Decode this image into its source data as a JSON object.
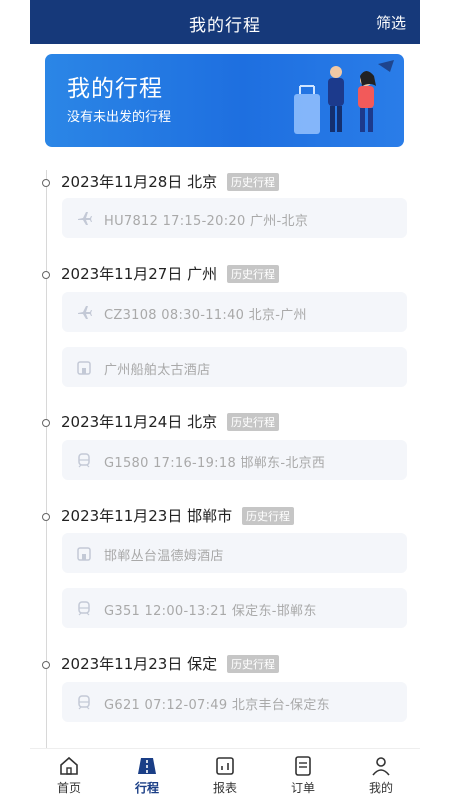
{
  "header": {
    "title": "我的行程",
    "filter_label": "筛选"
  },
  "banner": {
    "title": "我的行程",
    "subtitle": "没有未出发的行程"
  },
  "days": [
    {
      "date": "2023年11月28日 北京",
      "tag": "历史行程",
      "items": [
        {
          "icon": "plane-icon",
          "text": "HU7812 17:15-20:20 广州-北京"
        }
      ]
    },
    {
      "date": "2023年11月27日 广州",
      "tag": "历史行程",
      "items": [
        {
          "icon": "plane-icon",
          "text": "CZ3108 08:30-11:40 北京-广州"
        },
        {
          "icon": "hotel-icon",
          "text": "广州船舶太古酒店"
        }
      ]
    },
    {
      "date": "2023年11月24日 北京",
      "tag": "历史行程",
      "items": [
        {
          "icon": "train-icon",
          "text": "G1580 17:16-19:18 邯郸东-北京西"
        }
      ]
    },
    {
      "date": "2023年11月23日 邯郸市",
      "tag": "历史行程",
      "items": [
        {
          "icon": "hotel-icon",
          "text": "邯郸丛台温德姆酒店"
        },
        {
          "icon": "train-icon",
          "text": "G351 12:00-13:21 保定东-邯郸东"
        }
      ]
    },
    {
      "date": "2023年11月23日 保定",
      "tag": "历史行程",
      "items": [
        {
          "icon": "train-icon",
          "text": "G621 07:12-07:49 北京丰台-保定东"
        }
      ]
    }
  ],
  "tabbar": {
    "items": [
      {
        "label": "首页",
        "icon": "home-icon"
      },
      {
        "label": "行程",
        "icon": "road-icon",
        "active": true
      },
      {
        "label": "报表",
        "icon": "chart-icon"
      },
      {
        "label": "订单",
        "icon": "order-icon"
      },
      {
        "label": "我的",
        "icon": "user-icon"
      }
    ]
  },
  "colors": {
    "header": "#16397a",
    "banner": "#2b86e6",
    "active_tab": "#1a3e86"
  }
}
